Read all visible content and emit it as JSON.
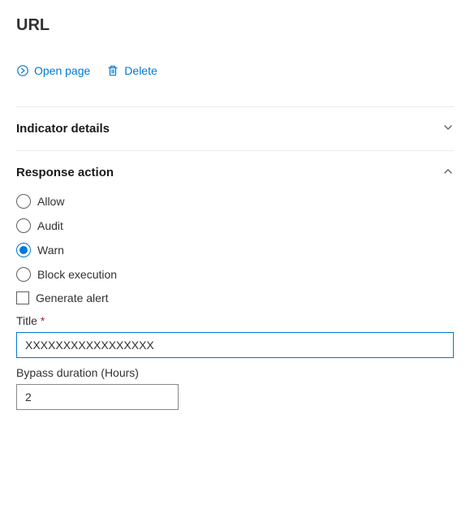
{
  "page": {
    "title": "URL"
  },
  "actions": {
    "openPageLabel": "Open page",
    "deleteLabel": "Delete"
  },
  "sections": {
    "indicatorDetails": {
      "title": "Indicator details",
      "expanded": false
    },
    "responseAction": {
      "title": "Response action",
      "expanded": true,
      "radios": {
        "allow": "Allow",
        "audit": "Audit",
        "warn": "Warn",
        "blockExecution": "Block execution",
        "selected": "warn"
      },
      "generateAlert": {
        "label": "Generate alert",
        "checked": false
      },
      "titleField": {
        "label": "Title",
        "required": "*",
        "value": "XXXXXXXXXXXXXXXXX"
      },
      "bypassDuration": {
        "label": "Bypass duration (Hours)",
        "value": "2"
      }
    }
  }
}
